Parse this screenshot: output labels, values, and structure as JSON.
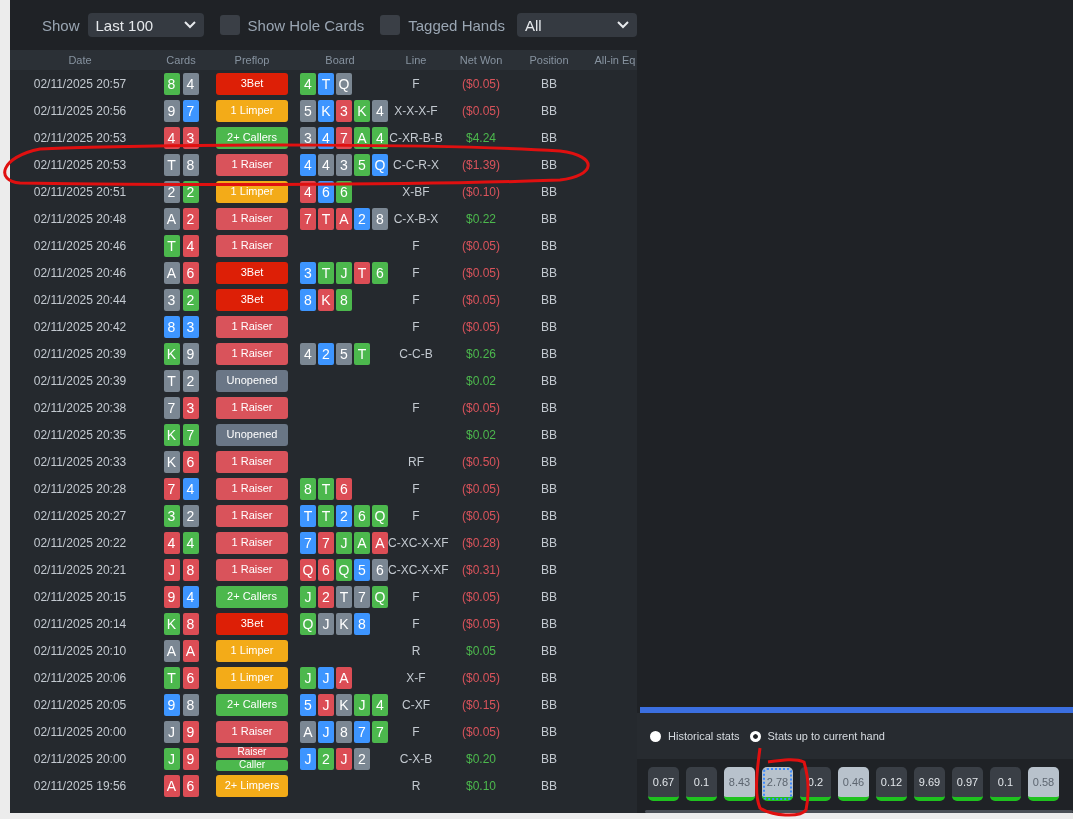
{
  "toolbar": {
    "show_label": "Show",
    "range_select": {
      "value": "Last 100"
    },
    "checkboxes": [
      {
        "label": "Show Hole Cards",
        "checked": false
      },
      {
        "label": "Tagged Hands",
        "checked": false
      }
    ],
    "filter_select": {
      "value": "All"
    }
  },
  "table": {
    "columns": [
      "Date",
      "Cards",
      "Preflop",
      "Board",
      "Line",
      "Net Won",
      "Position",
      "All-in Eq"
    ],
    "rows": [
      {
        "date": "02/11/2025 20:57",
        "cards": [
          {
            "rank": "8",
            "color": "#4cb84d"
          },
          {
            "rank": "4",
            "color": "#7b8793"
          }
        ],
        "preflop": [
          {
            "label": "3Bet",
            "kind": "threebet"
          }
        ],
        "board": [
          {
            "rank": "4",
            "color": "#4cb84d"
          },
          {
            "rank": "T",
            "color": "#3d95ff"
          },
          {
            "rank": "Q",
            "color": "#7b8793"
          }
        ],
        "line": "F",
        "net_won": {
          "text": "($0.05)",
          "color": "#d9535b"
        },
        "position": "BB"
      },
      {
        "date": "02/11/2025 20:56",
        "cards": [
          {
            "rank": "9",
            "color": "#7b8793"
          },
          {
            "rank": "7",
            "color": "#3d95ff"
          }
        ],
        "preflop": [
          {
            "label": "1 Limper",
            "kind": "limper"
          }
        ],
        "board": [
          {
            "rank": "5",
            "color": "#7b8793"
          },
          {
            "rank": "K",
            "color": "#3d95ff"
          },
          {
            "rank": "3",
            "color": "#dc4d55"
          },
          {
            "rank": "K",
            "color": "#4cb84d"
          },
          {
            "rank": "4",
            "color": "#7b8793"
          }
        ],
        "line": "X-X-X-F",
        "net_won": {
          "text": "($0.05)",
          "color": "#d9535b"
        },
        "position": "BB"
      },
      {
        "date": "02/11/2025 20:53",
        "cards": [
          {
            "rank": "4",
            "color": "#dc4d55"
          },
          {
            "rank": "3",
            "color": "#dc4d55"
          }
        ],
        "preflop": [
          {
            "label": "2+ Callers",
            "kind": "callers"
          }
        ],
        "board": [
          {
            "rank": "3",
            "color": "#7b8793"
          },
          {
            "rank": "4",
            "color": "#3d95ff"
          },
          {
            "rank": "7",
            "color": "#dc4d55"
          },
          {
            "rank": "A",
            "color": "#4cb84d"
          },
          {
            "rank": "4",
            "color": "#4cb84d"
          }
        ],
        "line": "C-XR-B-B",
        "net_won": {
          "text": "$4.24",
          "color": "#4cb84d"
        },
        "position": "BB"
      },
      {
        "date": "02/11/2025 20:53",
        "cards": [
          {
            "rank": "T",
            "color": "#7b8793"
          },
          {
            "rank": "8",
            "color": "#7b8793"
          }
        ],
        "preflop": [
          {
            "label": "1 Raiser",
            "kind": "raiser"
          }
        ],
        "board": [
          {
            "rank": "4",
            "color": "#3d95ff"
          },
          {
            "rank": "4",
            "color": "#7b8793"
          },
          {
            "rank": "3",
            "color": "#7b8793"
          },
          {
            "rank": "5",
            "color": "#4cb84d"
          },
          {
            "rank": "Q",
            "color": "#3d95ff"
          }
        ],
        "line": "C-C-R-X",
        "net_won": {
          "text": "($1.39)",
          "color": "#d9535b"
        },
        "position": "BB"
      },
      {
        "date": "02/11/2025 20:51",
        "cards": [
          {
            "rank": "2",
            "color": "#7b8793"
          },
          {
            "rank": "2",
            "color": "#4cb84d"
          }
        ],
        "preflop": [
          {
            "label": "1 Limper",
            "kind": "limper"
          }
        ],
        "board": [
          {
            "rank": "4",
            "color": "#dc4d55"
          },
          {
            "rank": "6",
            "color": "#3d95ff"
          },
          {
            "rank": "6",
            "color": "#4cb84d"
          }
        ],
        "line": "X-BF",
        "net_won": {
          "text": "($0.10)",
          "color": "#d9535b"
        },
        "position": "BB"
      },
      {
        "date": "02/11/2025 20:48",
        "cards": [
          {
            "rank": "A",
            "color": "#7b8793"
          },
          {
            "rank": "2",
            "color": "#dc4d55"
          }
        ],
        "preflop": [
          {
            "label": "1 Raiser",
            "kind": "raiser"
          }
        ],
        "board": [
          {
            "rank": "7",
            "color": "#dc4d55"
          },
          {
            "rank": "T",
            "color": "#dc4d55"
          },
          {
            "rank": "A",
            "color": "#dc4d55"
          },
          {
            "rank": "2",
            "color": "#3d95ff"
          },
          {
            "rank": "8",
            "color": "#7b8793"
          }
        ],
        "line": "C-X-B-X",
        "net_won": {
          "text": "$0.22",
          "color": "#4cb84d"
        },
        "position": "BB"
      },
      {
        "date": "02/11/2025 20:46",
        "cards": [
          {
            "rank": "T",
            "color": "#4cb84d"
          },
          {
            "rank": "4",
            "color": "#dc4d55"
          }
        ],
        "preflop": [
          {
            "label": "1 Raiser",
            "kind": "raiser"
          }
        ],
        "board": [],
        "line": "F",
        "net_won": {
          "text": "($0.05)",
          "color": "#d9535b"
        },
        "position": "BB"
      },
      {
        "date": "02/11/2025 20:46",
        "cards": [
          {
            "rank": "A",
            "color": "#7b8793"
          },
          {
            "rank": "6",
            "color": "#dc4d55"
          }
        ],
        "preflop": [
          {
            "label": "3Bet",
            "kind": "threebet"
          }
        ],
        "board": [
          {
            "rank": "3",
            "color": "#3d95ff"
          },
          {
            "rank": "T",
            "color": "#4cb84d"
          },
          {
            "rank": "J",
            "color": "#4cb84d"
          },
          {
            "rank": "T",
            "color": "#dc4d55"
          },
          {
            "rank": "6",
            "color": "#4cb84d"
          }
        ],
        "line": "F",
        "net_won": {
          "text": "($0.05)",
          "color": "#d9535b"
        },
        "position": "BB"
      },
      {
        "date": "02/11/2025 20:44",
        "cards": [
          {
            "rank": "3",
            "color": "#7b8793"
          },
          {
            "rank": "2",
            "color": "#4cb84d"
          }
        ],
        "preflop": [
          {
            "label": "3Bet",
            "kind": "threebet"
          }
        ],
        "board": [
          {
            "rank": "8",
            "color": "#3d95ff"
          },
          {
            "rank": "K",
            "color": "#dc4d55"
          },
          {
            "rank": "8",
            "color": "#4cb84d"
          }
        ],
        "line": "F",
        "net_won": {
          "text": "($0.05)",
          "color": "#d9535b"
        },
        "position": "BB"
      },
      {
        "date": "02/11/2025 20:42",
        "cards": [
          {
            "rank": "8",
            "color": "#3d95ff"
          },
          {
            "rank": "3",
            "color": "#3d95ff"
          }
        ],
        "preflop": [
          {
            "label": "1 Raiser",
            "kind": "raiser"
          }
        ],
        "board": [],
        "line": "F",
        "net_won": {
          "text": "($0.05)",
          "color": "#d9535b"
        },
        "position": "BB"
      },
      {
        "date": "02/11/2025 20:39",
        "cards": [
          {
            "rank": "K",
            "color": "#4cb84d"
          },
          {
            "rank": "9",
            "color": "#7b8793"
          }
        ],
        "preflop": [
          {
            "label": "1 Raiser",
            "kind": "raiser"
          }
        ],
        "board": [
          {
            "rank": "4",
            "color": "#7b8793"
          },
          {
            "rank": "2",
            "color": "#3d95ff"
          },
          {
            "rank": "5",
            "color": "#7b8793"
          },
          {
            "rank": "T",
            "color": "#4cb84d"
          }
        ],
        "line": "C-C-B",
        "net_won": {
          "text": "$0.26",
          "color": "#4cb84d"
        },
        "position": "BB"
      },
      {
        "date": "02/11/2025 20:39",
        "cards": [
          {
            "rank": "T",
            "color": "#7b8793"
          },
          {
            "rank": "2",
            "color": "#7b8793"
          }
        ],
        "preflop": [
          {
            "label": "Unopened",
            "kind": "unopened"
          }
        ],
        "board": [],
        "net_won": {
          "text": "$0.02",
          "color": "#4cb84d"
        },
        "position": "BB"
      },
      {
        "date": "02/11/2025 20:38",
        "cards": [
          {
            "rank": "7",
            "color": "#7b8793"
          },
          {
            "rank": "3",
            "color": "#dc4d55"
          }
        ],
        "preflop": [
          {
            "label": "1 Raiser",
            "kind": "raiser"
          }
        ],
        "board": [],
        "line": "F",
        "net_won": {
          "text": "($0.05)",
          "color": "#d9535b"
        },
        "position": "BB"
      },
      {
        "date": "02/11/2025 20:35",
        "cards": [
          {
            "rank": "K",
            "color": "#4cb84d"
          },
          {
            "rank": "7",
            "color": "#4cb84d"
          }
        ],
        "preflop": [
          {
            "label": "Unopened",
            "kind": "unopened"
          }
        ],
        "board": [],
        "net_won": {
          "text": "$0.02",
          "color": "#4cb84d"
        },
        "position": "BB"
      },
      {
        "date": "02/11/2025 20:33",
        "cards": [
          {
            "rank": "K",
            "color": "#7b8793"
          },
          {
            "rank": "6",
            "color": "#dc4d55"
          }
        ],
        "preflop": [
          {
            "label": "1 Raiser",
            "kind": "raiser"
          }
        ],
        "board": [],
        "line": "RF",
        "net_won": {
          "text": "($0.50)",
          "color": "#d9535b"
        },
        "position": "BB"
      },
      {
        "date": "02/11/2025 20:28",
        "cards": [
          {
            "rank": "7",
            "color": "#dc4d55"
          },
          {
            "rank": "4",
            "color": "#3d95ff"
          }
        ],
        "preflop": [
          {
            "label": "1 Raiser",
            "kind": "raiser"
          }
        ],
        "board": [
          {
            "rank": "8",
            "color": "#4cb84d"
          },
          {
            "rank": "T",
            "color": "#4cb84d"
          },
          {
            "rank": "6",
            "color": "#dc4d55"
          }
        ],
        "line": "F",
        "net_won": {
          "text": "($0.05)",
          "color": "#d9535b"
        },
        "position": "BB"
      },
      {
        "date": "02/11/2025 20:27",
        "cards": [
          {
            "rank": "3",
            "color": "#4cb84d"
          },
          {
            "rank": "2",
            "color": "#7b8793"
          }
        ],
        "preflop": [
          {
            "label": "1 Raiser",
            "kind": "raiser"
          }
        ],
        "board": [
          {
            "rank": "T",
            "color": "#3d95ff"
          },
          {
            "rank": "T",
            "color": "#4cb84d"
          },
          {
            "rank": "2",
            "color": "#3d95ff"
          },
          {
            "rank": "6",
            "color": "#4cb84d"
          },
          {
            "rank": "Q",
            "color": "#4cb84d"
          }
        ],
        "line": "F",
        "net_won": {
          "text": "($0.05)",
          "color": "#d9535b"
        },
        "position": "BB"
      },
      {
        "date": "02/11/2025 20:22",
        "cards": [
          {
            "rank": "4",
            "color": "#dc4d55"
          },
          {
            "rank": "4",
            "color": "#4cb84d"
          }
        ],
        "preflop": [
          {
            "label": "1 Raiser",
            "kind": "raiser"
          }
        ],
        "board": [
          {
            "rank": "7",
            "color": "#3d95ff"
          },
          {
            "rank": "7",
            "color": "#dc4d55"
          },
          {
            "rank": "J",
            "color": "#4cb84d"
          },
          {
            "rank": "A",
            "color": "#4cb84d"
          },
          {
            "rank": "A",
            "color": "#dc4d55"
          }
        ],
        "line": "C-XC-X-XF",
        "net_won": {
          "text": "($0.28)",
          "color": "#d9535b"
        },
        "position": "BB"
      },
      {
        "date": "02/11/2025 20:21",
        "cards": [
          {
            "rank": "J",
            "color": "#dc4d55"
          },
          {
            "rank": "8",
            "color": "#dc4d55"
          }
        ],
        "preflop": [
          {
            "label": "1 Raiser",
            "kind": "raiser"
          }
        ],
        "board": [
          {
            "rank": "Q",
            "color": "#dc4d55"
          },
          {
            "rank": "6",
            "color": "#dc4d55"
          },
          {
            "rank": "Q",
            "color": "#4cb84d"
          },
          {
            "rank": "5",
            "color": "#3d95ff"
          },
          {
            "rank": "6",
            "color": "#7b8793"
          }
        ],
        "line": "C-XC-X-XF",
        "net_won": {
          "text": "($0.31)",
          "color": "#d9535b"
        },
        "position": "BB"
      },
      {
        "date": "02/11/2025 20:15",
        "cards": [
          {
            "rank": "9",
            "color": "#dc4d55"
          },
          {
            "rank": "4",
            "color": "#3d95ff"
          }
        ],
        "preflop": [
          {
            "label": "2+ Callers",
            "kind": "callers"
          }
        ],
        "board": [
          {
            "rank": "J",
            "color": "#4cb84d"
          },
          {
            "rank": "2",
            "color": "#dc4d55"
          },
          {
            "rank": "T",
            "color": "#7b8793"
          },
          {
            "rank": "7",
            "color": "#7b8793"
          },
          {
            "rank": "Q",
            "color": "#4cb84d"
          }
        ],
        "line": "F",
        "net_won": {
          "text": "($0.05)",
          "color": "#d9535b"
        },
        "position": "BB"
      },
      {
        "date": "02/11/2025 20:14",
        "cards": [
          {
            "rank": "K",
            "color": "#4cb84d"
          },
          {
            "rank": "8",
            "color": "#dc4d55"
          }
        ],
        "preflop": [
          {
            "label": "3Bet",
            "kind": "threebet"
          }
        ],
        "board": [
          {
            "rank": "Q",
            "color": "#4cb84d"
          },
          {
            "rank": "J",
            "color": "#7b8793"
          },
          {
            "rank": "K",
            "color": "#7b8793"
          },
          {
            "rank": "8",
            "color": "#3d95ff"
          }
        ],
        "line": "F",
        "net_won": {
          "text": "($0.05)",
          "color": "#d9535b"
        },
        "position": "BB"
      },
      {
        "date": "02/11/2025 20:10",
        "cards": [
          {
            "rank": "A",
            "color": "#7b8793"
          },
          {
            "rank": "A",
            "color": "#dc4d55"
          }
        ],
        "preflop": [
          {
            "label": "1 Limper",
            "kind": "limper"
          }
        ],
        "board": [],
        "line": "R",
        "net_won": {
          "text": "$0.05",
          "color": "#4cb84d"
        },
        "position": "BB"
      },
      {
        "date": "02/11/2025 20:06",
        "cards": [
          {
            "rank": "T",
            "color": "#4cb84d"
          },
          {
            "rank": "6",
            "color": "#dc4d55"
          }
        ],
        "preflop": [
          {
            "label": "1 Limper",
            "kind": "limper"
          }
        ],
        "board": [
          {
            "rank": "J",
            "color": "#4cb84d"
          },
          {
            "rank": "J",
            "color": "#3d95ff"
          },
          {
            "rank": "A",
            "color": "#dc4d55"
          }
        ],
        "line": "X-F",
        "net_won": {
          "text": "($0.05)",
          "color": "#d9535b"
        },
        "position": "BB"
      },
      {
        "date": "02/11/2025 20:05",
        "cards": [
          {
            "rank": "9",
            "color": "#3d95ff"
          },
          {
            "rank": "8",
            "color": "#7b8793"
          }
        ],
        "preflop": [
          {
            "label": "2+ Callers",
            "kind": "callers"
          }
        ],
        "board": [
          {
            "rank": "5",
            "color": "#3d95ff"
          },
          {
            "rank": "J",
            "color": "#dc4d55"
          },
          {
            "rank": "K",
            "color": "#7b8793"
          },
          {
            "rank": "J",
            "color": "#4cb84d"
          },
          {
            "rank": "4",
            "color": "#4cb84d"
          }
        ],
        "line": "C-XF",
        "net_won": {
          "text": "($0.15)",
          "color": "#d9535b"
        },
        "position": "BB"
      },
      {
        "date": "02/11/2025 20:00",
        "cards": [
          {
            "rank": "J",
            "color": "#7b8793"
          },
          {
            "rank": "9",
            "color": "#dc4d55"
          }
        ],
        "preflop": [
          {
            "label": "1 Raiser",
            "kind": "raiser"
          }
        ],
        "board": [
          {
            "rank": "A",
            "color": "#7b8793"
          },
          {
            "rank": "J",
            "color": "#3d95ff"
          },
          {
            "rank": "8",
            "color": "#7b8793"
          },
          {
            "rank": "7",
            "color": "#3d95ff"
          },
          {
            "rank": "7",
            "color": "#4cb84d"
          }
        ],
        "line": "F",
        "net_won": {
          "text": "($0.05)",
          "color": "#d9535b"
        },
        "position": "BB"
      },
      {
        "date": "02/11/2025 20:00",
        "cards": [
          {
            "rank": "J",
            "color": "#4cb84d"
          },
          {
            "rank": "9",
            "color": "#dc4d55"
          }
        ],
        "preflop": [
          {
            "label": "Raiser",
            "kind": "raiser"
          },
          {
            "label": "Caller",
            "kind": "callers"
          }
        ],
        "board": [
          {
            "rank": "J",
            "color": "#3d95ff"
          },
          {
            "rank": "2",
            "color": "#4cb84d"
          },
          {
            "rank": "J",
            "color": "#dc4d55"
          },
          {
            "rank": "2",
            "color": "#7b8793"
          }
        ],
        "line": "C-X-B",
        "net_won": {
          "text": "$0.20",
          "color": "#4cb84d"
        },
        "position": "BB"
      },
      {
        "date": "02/11/2025 19:56",
        "cards": [
          {
            "rank": "A",
            "color": "#dc4d55"
          },
          {
            "rank": "6",
            "color": "#dc4d55"
          }
        ],
        "preflop": [
          {
            "label": "2+ Limpers",
            "kind": "limper"
          }
        ],
        "board": [],
        "line": "R",
        "net_won": {
          "text": "$0.10",
          "color": "#4cb84d"
        },
        "position": "BB"
      }
    ]
  },
  "stats_panel": {
    "modes": [
      {
        "label": "Historical stats",
        "selected": false
      },
      {
        "label": "Stats up to current hand",
        "selected": true
      }
    ],
    "tiles": [
      {
        "value": "0.67",
        "highlighted": false,
        "selected": false
      },
      {
        "value": "0.1",
        "highlighted": false,
        "selected": false
      },
      {
        "value": "8.43",
        "highlighted": true,
        "selected": false
      },
      {
        "value": "2.78",
        "highlighted": true,
        "selected": true
      },
      {
        "value": "0.2",
        "highlighted": false,
        "selected": false
      },
      {
        "value": "0.46",
        "highlighted": true,
        "selected": false
      },
      {
        "value": "0.12",
        "highlighted": false,
        "selected": false
      },
      {
        "value": "9.69",
        "highlighted": false,
        "selected": false
      },
      {
        "value": "0.97",
        "highlighted": false,
        "selected": false
      },
      {
        "value": "0.1",
        "highlighted": false,
        "selected": false
      },
      {
        "value": "0.58",
        "highlighted": true,
        "selected": false
      }
    ]
  }
}
